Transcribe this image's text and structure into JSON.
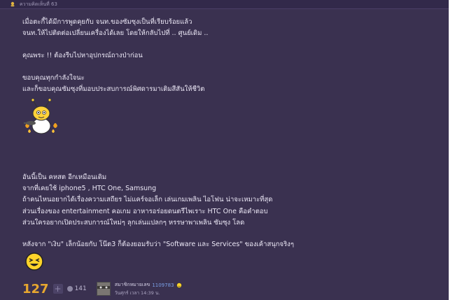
{
  "header": {
    "title": "ความคิดเห็นที่ 63"
  },
  "post": {
    "lines": [
      "เมื่อตะกี้ได้มีการพูดคุยกับ จนท.ของซัมซุงเป็นที่เรียบร้อยแล้ว",
      "จนท.ให้ไปติดต่อเปลี่ยนเครื่องได้เลย โดยให้กลับไปที่ .. ศูนย์เดิม ..",
      "",
      "คุณพระ !! ต้องรีบไปหาอุปกรณ์ถางป่าก่อน",
      "",
      "ขอบคุณทุกกำลังใจนะ",
      "และก็ขอบคุณซัมซุงที่มอบประสบการณ์พิศดารมาเติมสีสันให้ชีวิต"
    ],
    "lower_lines": [
      "อันนี้เป็น คหสต อีกเหมือนเดิม",
      "จากที่เคยใช้ iphone5 , HTC One, Samsung",
      "ถ้าคนไหนอยากได้เรื่องความเสถียร ไม่แคร์จอเล็ก เล่นเกมเพลิน ไอโฟน น่าจะเหมาะที่สุด",
      "ส่วนเรื่องของ entertainment คอเกม อาหารอร่อยดนตรีไพเราะ  HTC One คือคำตอบ",
      "ส่วนใครอยากเปิดประสบการณ์ใหม่ๆ ลุกเล่นแปลกๆ หรรษาพาเพลิน ซัมซุง โลด"
    ],
    "closing_line": "หลังจาก \"เงิบ\" เล็กน้อยกับ โน๊ต3 ก็ต้องยอมรับว่า \"Software และ Services\" ของเค้าสนุกจริงๆ"
  },
  "footer": {
    "score": "127",
    "plus_symbol": "+",
    "count": "141",
    "member_prefix": "สมาชิกหมายเลข",
    "member_id": "1109783",
    "timestamp": "วันศุกร์ เวลา 14:39 น."
  },
  "colors": {
    "panel_bg": "#3a3150",
    "text": "#ece8f6",
    "score": "#e7a72f",
    "member_link": "#7aa0e6"
  },
  "icons": {
    "header_icon": "emoticon-icon",
    "sticker_1": "monster-chef-sticker",
    "sticker_2": "laughing-smiley-sticker",
    "member_emoji": "smiley-icon"
  }
}
